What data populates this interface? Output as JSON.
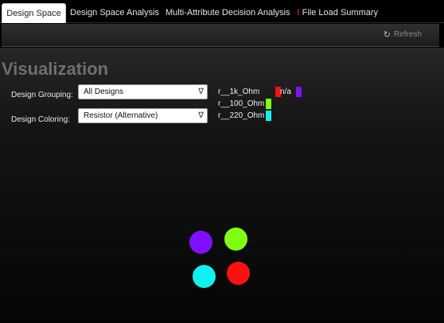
{
  "tabs": [
    {
      "label": "Design Space",
      "active": true
    },
    {
      "label": "Design Space Analysis",
      "active": false
    },
    {
      "label": "Multi-Attribute Decision Analysis",
      "active": false
    },
    {
      "label": "File Load Summary",
      "active": false,
      "warning": "!"
    }
  ],
  "toolbar": {
    "refresh_label": "Refresh",
    "refresh_icon": "refresh-icon"
  },
  "main": {
    "title": "Visualization",
    "grouping": {
      "label": "Design Grouping:",
      "value": "All Designs"
    },
    "coloring": {
      "label": "Design Coloring:",
      "value": "Resistor (Alternative)"
    },
    "legend": [
      {
        "label": "r__1k_Ohm",
        "color": "#ff1010"
      },
      {
        "label": "r__100_Ohm",
        "color": "#80ff10"
      },
      {
        "label": "r__220_Ohm",
        "color": "#10f0f0"
      },
      {
        "label": "n/a",
        "color": "#8010ff"
      }
    ]
  },
  "points": [
    {
      "series": "n/a",
      "color": "#8010ff"
    },
    {
      "series": "r__100_Ohm",
      "color": "#80ff10"
    },
    {
      "series": "r__220_Ohm",
      "color": "#10f0f0"
    },
    {
      "series": "r__1k_Ohm",
      "color": "#ff1010"
    }
  ]
}
